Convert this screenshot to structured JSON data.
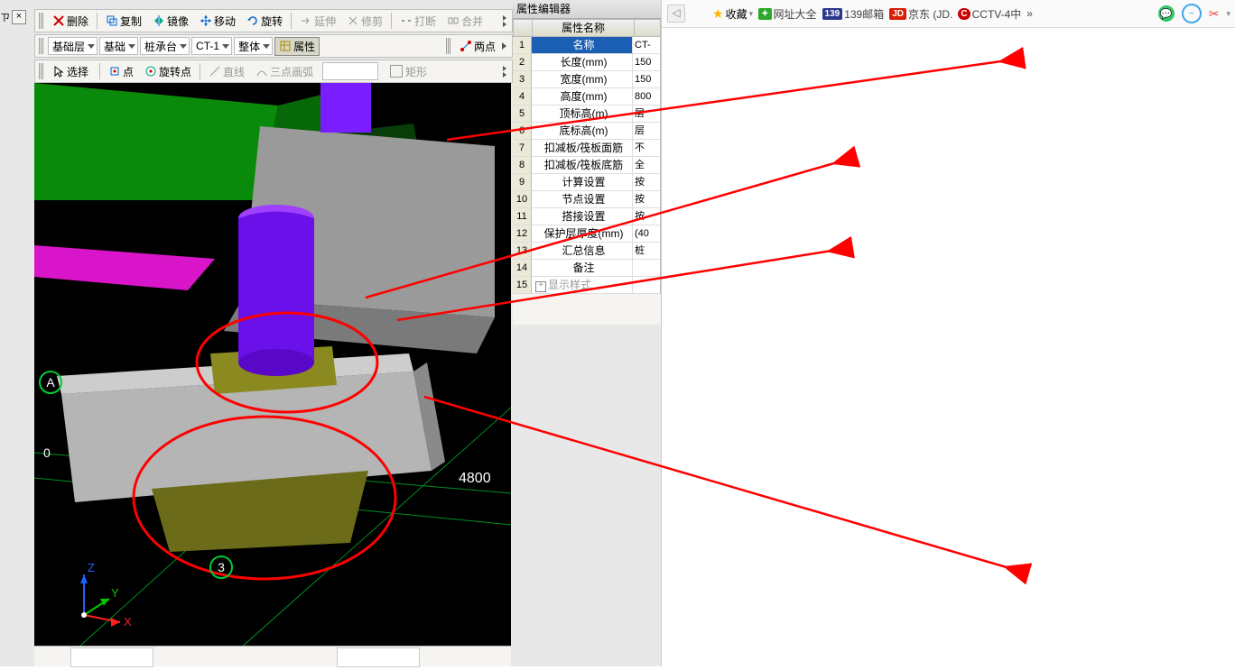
{
  "pin_label": "ㄗ",
  "toolbar1": {
    "delete": "删除",
    "copy": "复制",
    "mirror": "镜像",
    "move": "移动",
    "rotate": "旋转",
    "extend": "延伸",
    "trim": "修剪",
    "break": "打断",
    "merge": "合并"
  },
  "toolbar2": {
    "layer": "基础层",
    "category": "基础",
    "component": "桩承台",
    "type": "CT-1",
    "filter": "整体",
    "attribute": "属性",
    "points": "两点"
  },
  "toolbar3": {
    "select": "选择",
    "point": "点",
    "pivot": "旋转点",
    "line": "直线",
    "arc": "三点画弧",
    "rect": "矩形"
  },
  "prop": {
    "title": "属性编辑器",
    "header": "属性名称",
    "rows": [
      {
        "n": "1",
        "k": "名称",
        "v": "CT-"
      },
      {
        "n": "2",
        "k": "长度(mm)",
        "v": "150"
      },
      {
        "n": "3",
        "k": "宽度(mm)",
        "v": "150"
      },
      {
        "n": "4",
        "k": "高度(mm)",
        "v": "800"
      },
      {
        "n": "5",
        "k": "顶标高(m)",
        "v": "层"
      },
      {
        "n": "6",
        "k": "底标高(m)",
        "v": "层"
      },
      {
        "n": "7",
        "k": "扣减板/筏板面筋",
        "v": "不"
      },
      {
        "n": "8",
        "k": "扣减板/筏板底筋",
        "v": "全"
      },
      {
        "n": "9",
        "k": "计算设置",
        "v": "按"
      },
      {
        "n": "10",
        "k": "节点设置",
        "v": "按"
      },
      {
        "n": "11",
        "k": "搭接设置",
        "v": "按"
      },
      {
        "n": "12",
        "k": "保护层厚度(mm)",
        "v": "(40"
      },
      {
        "n": "13",
        "k": "汇总信息",
        "v": "桩"
      },
      {
        "n": "14",
        "k": "备注",
        "v": ""
      },
      {
        "n": "15",
        "k": "显示样式",
        "v": ""
      }
    ]
  },
  "viewport": {
    "axis_label_A": "A",
    "dim_0": "0",
    "dim_4800": "4800",
    "node_3": "3",
    "axis_x": "X",
    "axis_y": "Y",
    "axis_z": "Z"
  },
  "browser": {
    "fav": "收藏",
    "wzdq": "网址大全",
    "m139": "139邮箱",
    "jd": "京东 (JD.",
    "cctv": "CCTV-4中",
    "more": "»",
    "tri": "▾"
  }
}
